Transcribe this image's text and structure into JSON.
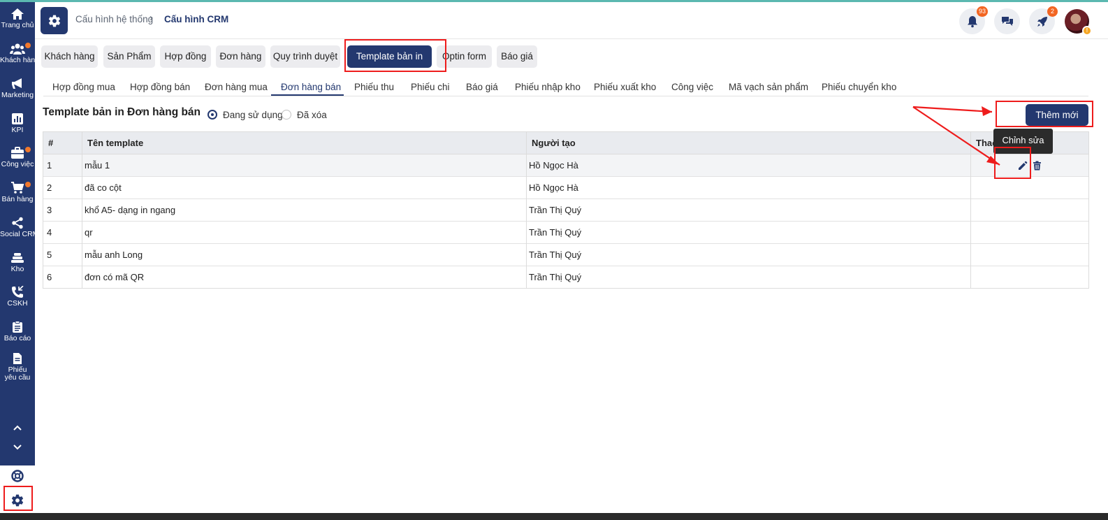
{
  "sidebar": {
    "items": [
      {
        "label": "Trang chủ",
        "icon": "home-icon"
      },
      {
        "label": "Khách hàng",
        "icon": "users-icon",
        "dot": true
      },
      {
        "label": "Marketing",
        "icon": "megaphone-icon"
      },
      {
        "label": "KPI",
        "icon": "chart-icon"
      },
      {
        "label": "Công việc",
        "icon": "briefcase-icon",
        "dot": true
      },
      {
        "label": "Bán hàng",
        "icon": "cart-icon",
        "dot": true
      },
      {
        "label": "Social CRM",
        "icon": "share-icon"
      },
      {
        "label": "Kho",
        "icon": "warehouse-icon"
      },
      {
        "label": "CSKH",
        "icon": "phone-icon"
      },
      {
        "label": "Báo cáo",
        "icon": "clipboard-icon"
      },
      {
        "label": "Phiếu yêu cầu",
        "icon": "document-icon"
      }
    ]
  },
  "header": {
    "breadcrumb": [
      "Cấu hình hệ thống",
      "Cấu hình CRM"
    ],
    "notification_count": "93",
    "rocket_count": "2",
    "avatar_badge": "!"
  },
  "config_tabs": [
    "Khách hàng",
    "Sản Phẩm",
    "Hợp đồng",
    "Đơn hàng",
    "Quy trình duyệt",
    "Template bản in",
    "Optin form",
    "Báo giá"
  ],
  "config_tab_active": "Template bản in",
  "sub_tabs": [
    "Hợp đồng mua",
    "Hợp đồng bán",
    "Đơn hàng mua",
    "Đơn hàng bán",
    "Phiếu thu",
    "Phiếu chi",
    "Báo giá",
    "Phiếu nhập kho",
    "Phiếu xuất kho",
    "Công việc",
    "Mã vạch sản phẩm",
    "Phiếu chuyển kho"
  ],
  "sub_tab_active": "Đơn hàng bán",
  "page": {
    "title": "Template bản in Đơn hàng bán",
    "filter_active": "Đang sử dụng",
    "filter_deleted": "Đã xóa",
    "add_button": "Thêm mới"
  },
  "table": {
    "columns": [
      "#",
      "Tên template",
      "Người tạo",
      "Thao tác"
    ],
    "rows": [
      {
        "no": "1",
        "name": "mẫu 1",
        "creator": "Hồ Ngọc Hà"
      },
      {
        "no": "2",
        "name": "đã co cột",
        "creator": "Hồ Ngọc Hà"
      },
      {
        "no": "3",
        "name": "khổ A5- dạng in ngang",
        "creator": "Trần Thị Quý"
      },
      {
        "no": "4",
        "name": "qr",
        "creator": "Trần Thị Quý"
      },
      {
        "no": "5",
        "name": "mẫu anh Long",
        "creator": "Trần Thị Quý"
      },
      {
        "no": "6",
        "name": "đơn có mã QR",
        "creator": "Trần Thị Quý"
      }
    ],
    "tooltip": "Chỉnh sửa"
  },
  "colors": {
    "primary": "#23386f",
    "badge": "#f26522",
    "annotation": "#ee1c1c"
  }
}
